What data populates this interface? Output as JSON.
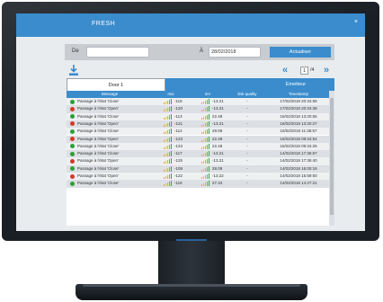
{
  "app": {
    "title": "FRESH",
    "close": "×"
  },
  "filter": {
    "from_label": "De",
    "from_value": "",
    "to_label": "À",
    "to_value": "28/02/2018",
    "update_button": "Actualiser"
  },
  "pager": {
    "first": "«",
    "current": "1",
    "total": "/4",
    "last": "»"
  },
  "tabs": [
    {
      "label": "Door 1"
    },
    {
      "label": "Emetteur"
    }
  ],
  "table": {
    "headers": [
      "Message",
      "rssi",
      "snr",
      "link quality",
      "Timestamp"
    ],
    "rows": [
      {
        "status": "ok",
        "message": "Passage à l'état 'Close'",
        "rssi": "-116",
        "snr": "-13.21",
        "lq": "-",
        "ts": "17/02/2018 20:34:58"
      },
      {
        "status": "err",
        "message": "Passage à l'état 'Open'",
        "rssi": "-120",
        "snr": "-13.21",
        "lq": "-",
        "ts": "17/02/2018 20:34:38"
      },
      {
        "status": "ok",
        "message": "Passage à l'état 'Close'",
        "rssi": "-113",
        "snr": "22.48",
        "lq": "-",
        "ts": "16/02/2018 13:20:55"
      },
      {
        "status": "err",
        "message": "Passage à l'état 'Open'",
        "rssi": "-121",
        "snr": "-13.21",
        "lq": "-",
        "ts": "16/02/2018 13:20:27"
      },
      {
        "status": "ok",
        "message": "Passage à l'état 'Close'",
        "rssi": "-112",
        "snr": "28.09",
        "lq": "-",
        "ts": "15/02/2018 11:36:57"
      },
      {
        "status": "err",
        "message": "Passage à l'état 'Open'",
        "rssi": "-123",
        "snr": "22.48",
        "lq": "-",
        "ts": "15/02/2018 09:34:54"
      },
      {
        "status": "ok",
        "message": "Passage à l'état 'Close'",
        "rssi": "-123",
        "snr": "22.48",
        "lq": "-",
        "ts": "15/02/2018 09:34:25"
      },
      {
        "status": "ok",
        "message": "Passage à l'état 'Close'",
        "rssi": "-117",
        "snr": "-13.21",
        "lq": "-",
        "ts": "14/02/2018 17:36:57"
      },
      {
        "status": "err",
        "message": "Passage à l'état 'Open'",
        "rssi": "-125",
        "snr": "-13.21",
        "lq": "-",
        "ts": "14/02/2018 17:36:40"
      },
      {
        "status": "ok",
        "message": "Passage à l'état 'Close'",
        "rssi": "-109",
        "snr": "28.09",
        "lq": "-",
        "ts": "14/02/2018 16:00:16"
      },
      {
        "status": "err",
        "message": "Passage à l'état 'Open'",
        "rssi": "-122",
        "snr": "-13.22",
        "lq": "-",
        "ts": "14/02/2018 15:59:50"
      },
      {
        "status": "ok",
        "message": "Passage à l'état 'Close'",
        "rssi": "-116",
        "snr": "27.34",
        "lq": "-",
        "ts": "14/02/2018 14:27:21"
      }
    ]
  },
  "colors": {
    "accent": "#3a8ccc",
    "ok": "#2f9e3a",
    "error": "#d23a2a"
  },
  "icons": {
    "download": "download-icon",
    "status_ok": "check-circle-icon",
    "status_err": "alert-circle-icon",
    "signal": "signal-bars-icon"
  }
}
